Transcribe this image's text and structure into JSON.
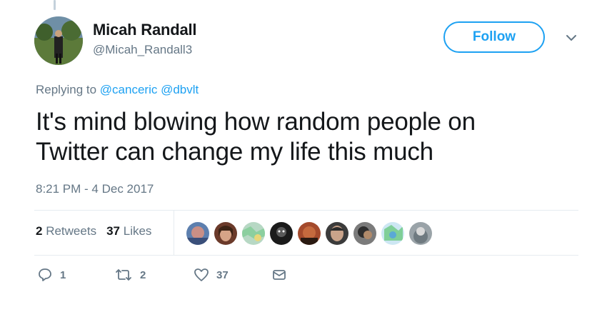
{
  "tweet": {
    "author": {
      "display_name": "Micah Randall",
      "username": "@Micah_Randall3"
    },
    "follow_label": "Follow",
    "replying_prefix": "Replying to",
    "mentions": [
      "@canceric",
      "@dbvlt"
    ],
    "text_line1": "It's mind blowing how random people on",
    "text_line2": "Twitter can change my life this much",
    "timestamp": "8:21 PM - 4 Dec 2017",
    "stats": {
      "retweets_count": "2",
      "retweets_label": "Retweets",
      "likes_count": "37",
      "likes_label": "Likes"
    },
    "actions": {
      "replies": "1",
      "retweets": "2",
      "likes": "37"
    }
  },
  "colors": {
    "accent": "#1da1f2",
    "muted": "#657786",
    "text": "#14171a",
    "divider": "#e6ecf0"
  },
  "icons": [
    "chevron-down-icon",
    "reply-icon",
    "retweet-icon",
    "heart-icon",
    "dm-envelope-icon"
  ]
}
